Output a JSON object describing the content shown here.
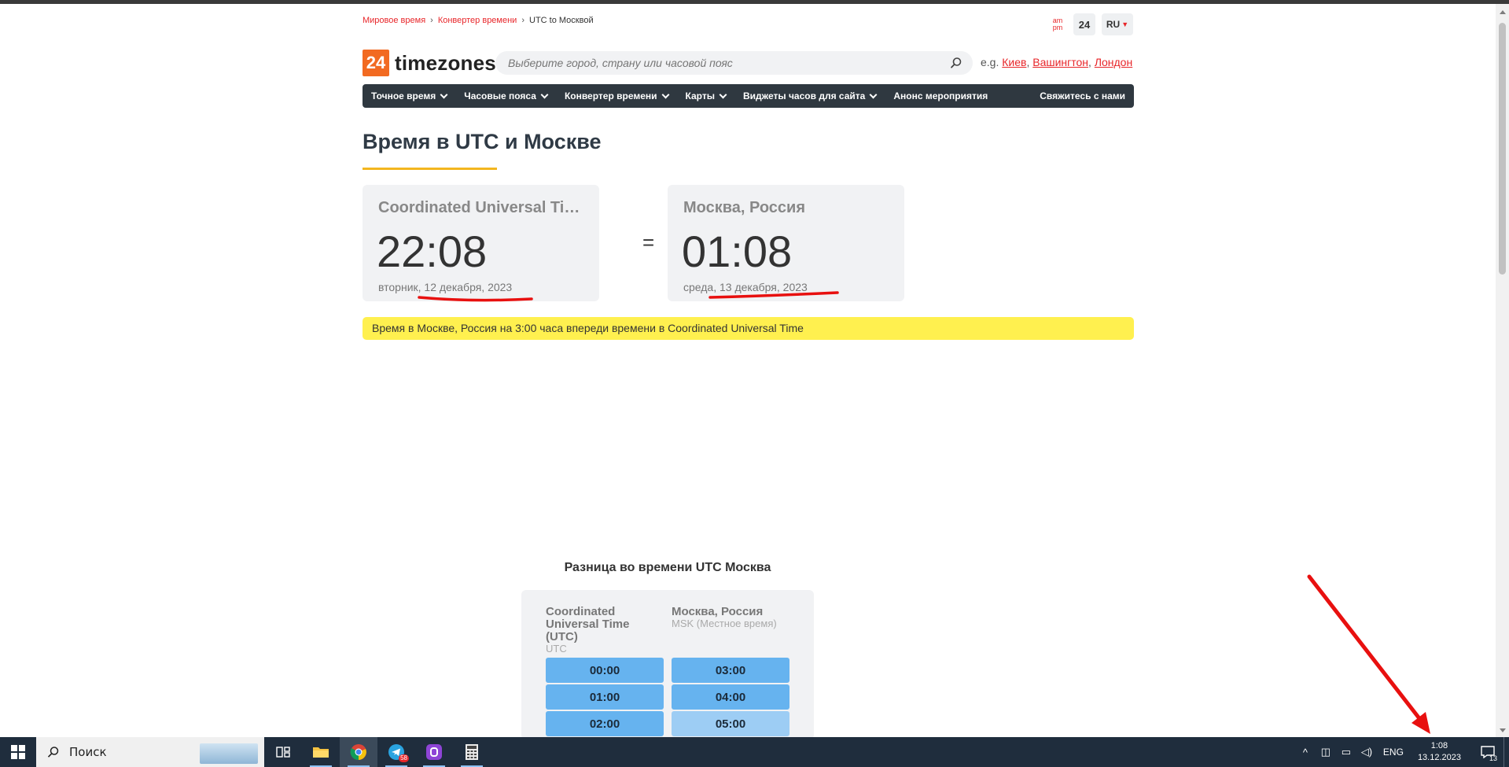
{
  "breadcrumb": {
    "items": [
      "Мировое время",
      "Конвертер времени"
    ],
    "current": "UTC to Москвой"
  },
  "tools": {
    "ampm_top": "am",
    "ampm_bottom": "pm",
    "h24": "24",
    "lang": "RU"
  },
  "logo": {
    "number": "24",
    "name": "timezones"
  },
  "search": {
    "placeholder": "Выберите город, страну или часовой пояс"
  },
  "examples": {
    "prefix": "e.g.",
    "cities": [
      "Киев",
      "Вашингтон",
      "Лондон"
    ]
  },
  "nav": {
    "items": [
      "Точное время",
      "Часовые пояса",
      "Конвертер времени",
      "Карты",
      "Виджеты часов для сайта",
      "Анонс мероприятия"
    ],
    "contact": "Свяжитесь с нами"
  },
  "page": {
    "title": "Время в UTC и Москве"
  },
  "cards": {
    "utc": {
      "city": "Coordinated Universal Time (UTC)",
      "time": "22:08",
      "weekday": "вторник",
      "date": "12 декабря, 2023"
    },
    "msk": {
      "city": "Москва, Россия",
      "time": "01:08",
      "weekday": "среда",
      "date": "13 декабря, 2023"
    },
    "equals": "="
  },
  "info": "Время в Москве, Россия на 3:00 часа впереди времени в Coordinated Universal Time",
  "diff": {
    "title": "Разница во времени UTC Москва",
    "utc": {
      "name": "Coordinated Universal Time (UTC)",
      "sub": "UTC",
      "slots": [
        "00:00",
        "01:00",
        "02:00"
      ]
    },
    "msk": {
      "name": "Москва, Россия",
      "sub": "MSK (Местное время)",
      "slots": [
        "03:00",
        "04:00",
        "05:00"
      ]
    }
  },
  "taskbar": {
    "search_label": "Поиск",
    "telegram_badge": "58",
    "lang": "ENG",
    "time": "1:08",
    "date": "13.12.2023",
    "notifications": "13"
  },
  "colors": {
    "accent": "#e8262a",
    "logo": "#f26a21",
    "nav": "#2f3840",
    "info": "#fff04f",
    "slot": "#66b3ef"
  }
}
